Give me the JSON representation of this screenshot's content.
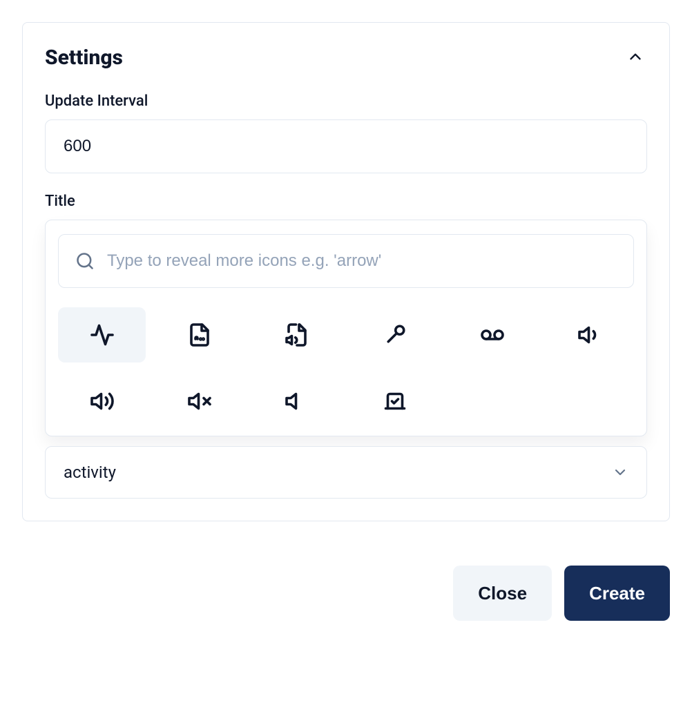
{
  "settings": {
    "title": "Settings",
    "update_interval": {
      "label": "Update Interval",
      "value": "600"
    },
    "title_field": {
      "label": "Title",
      "selected_value": "activity"
    }
  },
  "icon_picker": {
    "search_placeholder": "Type to reveal more icons e.g. 'arrow'",
    "selected": "activity",
    "icons": [
      "activity",
      "file-audio",
      "file-volume",
      "mic",
      "voicemail",
      "volume-low",
      "volume-high",
      "volume-x",
      "volume",
      "cast-check"
    ]
  },
  "footer": {
    "close_label": "Close",
    "create_label": "Create"
  }
}
